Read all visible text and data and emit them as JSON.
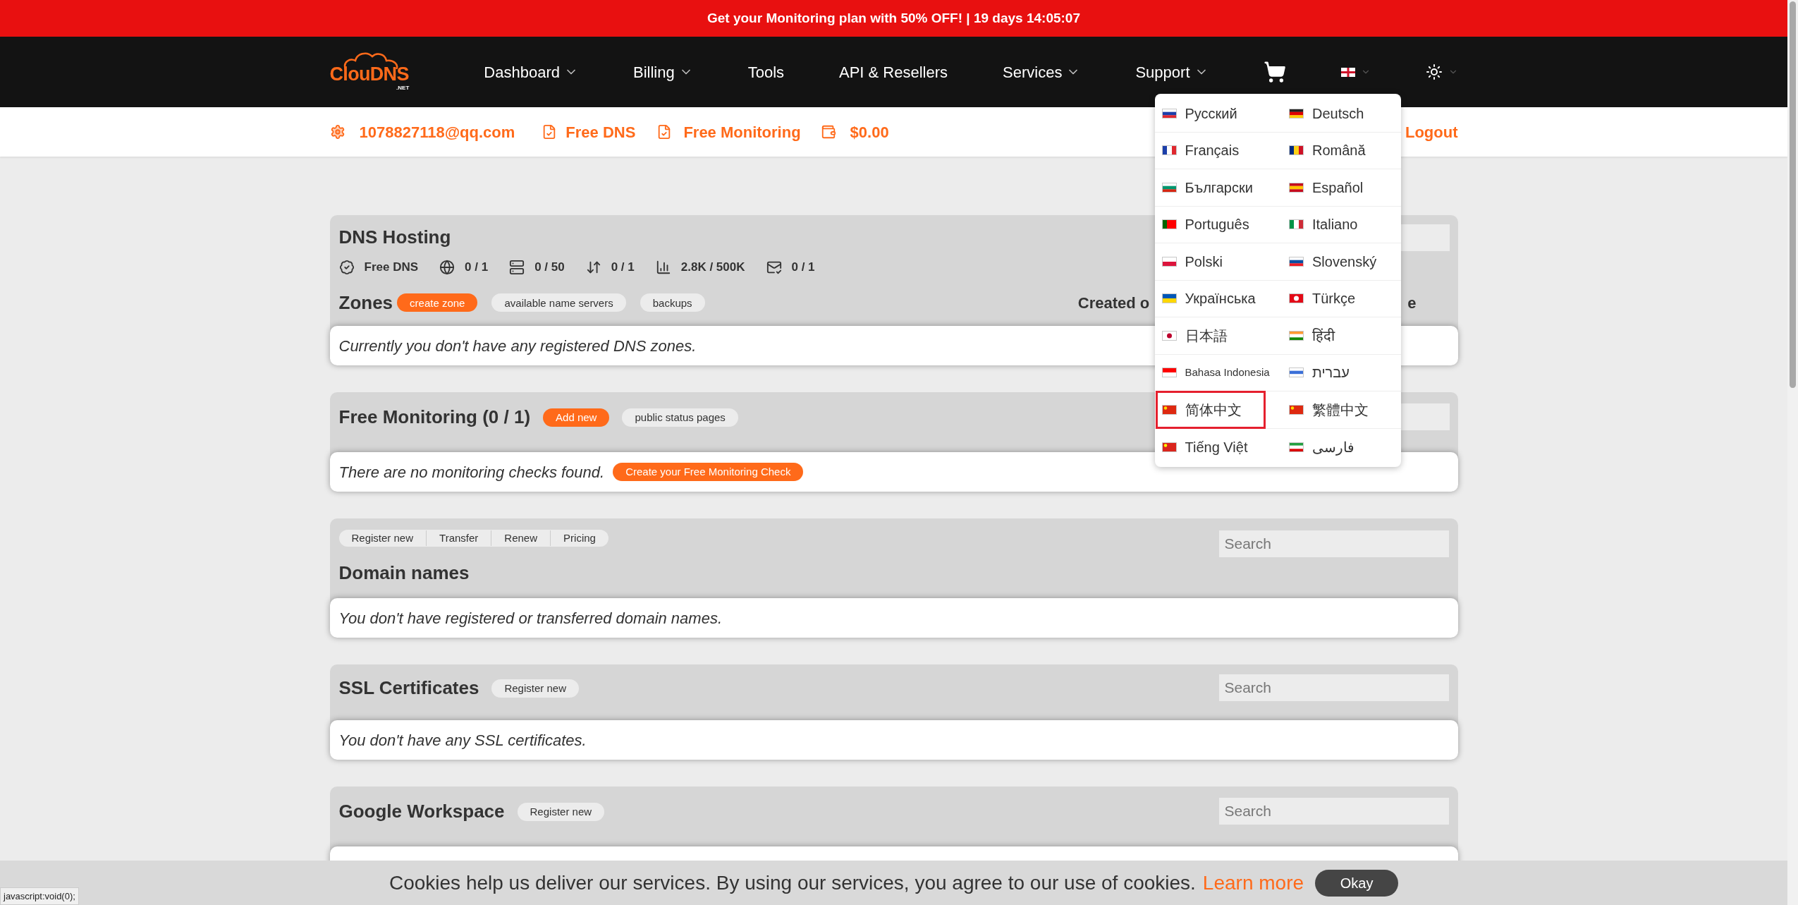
{
  "promo_banner": {
    "text": "Get your Monitoring plan with 50% OFF! | 19 days 14:05:07"
  },
  "logo": {
    "name": "ClouDNS",
    "suffix": ".NET"
  },
  "nav": [
    {
      "label": "Dashboard",
      "dropdown": true
    },
    {
      "label": "Billing",
      "dropdown": true
    },
    {
      "label": "Tools",
      "dropdown": false
    },
    {
      "label": "API & Resellers",
      "dropdown": false
    },
    {
      "label": "Services",
      "dropdown": true
    },
    {
      "label": "Support",
      "dropdown": true
    }
  ],
  "account_bar": {
    "email": "1078827118@qq.com",
    "plan_dns": "Free DNS",
    "plan_monitoring": "Free Monitoring",
    "balance": "$0.00",
    "logout": "Logout"
  },
  "language_menu": {
    "items": [
      {
        "label": "Русский",
        "selected": false
      },
      {
        "label": "Deutsch",
        "selected": false
      },
      {
        "label": "Français",
        "selected": false
      },
      {
        "label": "Română",
        "selected": false
      },
      {
        "label": "Български",
        "selected": false
      },
      {
        "label": "Español",
        "selected": false
      },
      {
        "label": "Português",
        "selected": false
      },
      {
        "label": "Italiano",
        "selected": false
      },
      {
        "label": "Polski",
        "selected": false
      },
      {
        "label": "Slovenský",
        "selected": false
      },
      {
        "label": "Українська",
        "selected": false
      },
      {
        "label": "Türkçe",
        "selected": false
      },
      {
        "label": "日本語",
        "selected": false
      },
      {
        "label": "हिंदी",
        "selected": false
      },
      {
        "label": "Bahasa Indonesia",
        "selected": false
      },
      {
        "label": "עברית",
        "selected": false
      },
      {
        "label": "简体中文",
        "selected": true
      },
      {
        "label": "繁體中文",
        "selected": false
      },
      {
        "label": "Tiếng Việt",
        "selected": false
      },
      {
        "label": "فارسی",
        "selected": false
      }
    ]
  },
  "dns_hosting": {
    "title": "DNS Hosting",
    "stats": [
      {
        "kind": "plan",
        "value": "Free DNS"
      },
      {
        "kind": "zones",
        "value": "0 / 1"
      },
      {
        "kind": "records",
        "value": "0 / 50"
      },
      {
        "kind": "transfers",
        "value": "0 / 1"
      },
      {
        "kind": "queries",
        "value": "2.8K / 500K"
      },
      {
        "kind": "mail",
        "value": "0 / 1"
      }
    ],
    "zones_label": "Zones",
    "buttons": [
      {
        "label": "create zone",
        "kind": "primary"
      },
      {
        "label": "available name servers",
        "kind": "secondary"
      },
      {
        "label": "backups",
        "kind": "secondary"
      }
    ],
    "columns": [
      "Created o",
      "e"
    ],
    "message": "Currently you don't have any registered DNS zones."
  },
  "free_monitoring": {
    "title": "Free Monitoring (0 / 1)",
    "buttons": [
      {
        "label": "Add new",
        "kind": "primary"
      },
      {
        "label": "public status pages",
        "kind": "secondary"
      }
    ],
    "message": "There are no monitoring checks found.",
    "action": "Create your Free Monitoring Check"
  },
  "domain_names": {
    "title": "Domain names",
    "tabs": [
      "Register new",
      "Transfer",
      "Renew",
      "Pricing"
    ],
    "search": {
      "placeholder": "Search"
    },
    "message": "You don't have registered or transferred domain names."
  },
  "ssl_certificates": {
    "title": "SSL Certificates",
    "button": "Register new",
    "search": {
      "placeholder": "Search"
    },
    "message": "You don't have any SSL certificates."
  },
  "google_workspace": {
    "title": "Google Workspace",
    "button": "Register new",
    "search": {
      "placeholder": "Search"
    }
  },
  "cookie_bar": {
    "text": "Cookies help us deliver our services. By using our services, you agree to our use of cookies.",
    "link": "Learn more",
    "button": "Okay"
  },
  "status_url": "javascript:void(0);"
}
